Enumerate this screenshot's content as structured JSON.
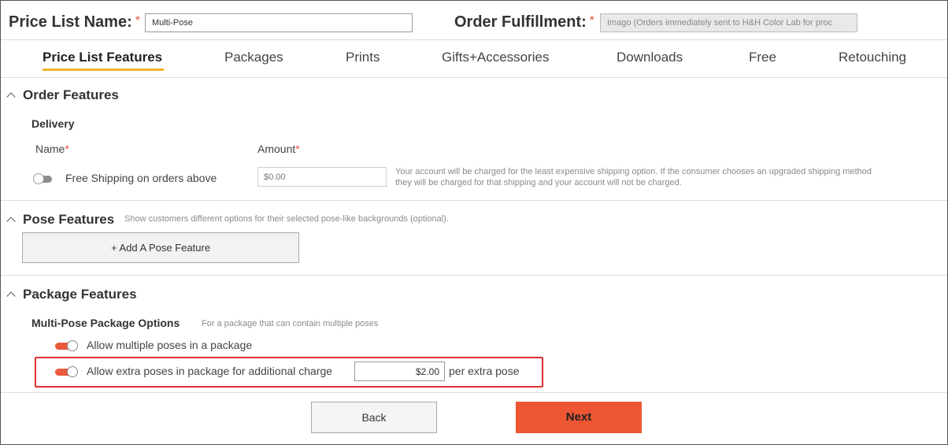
{
  "header": {
    "price_list_label": "Price List Name:",
    "required_mark": "*",
    "price_list_value": "Multi-Pose",
    "order_fulfillment_label": "Order Fulfillment:",
    "order_fulfillment_value": "Imago (Orders immediately sent to H&H Color Lab for proc"
  },
  "tabs": [
    {
      "label": "Price List Features",
      "active": true
    },
    {
      "label": "Packages",
      "active": false
    },
    {
      "label": "Prints",
      "active": false
    },
    {
      "label": "Gifts+Accessories",
      "active": false
    },
    {
      "label": "Downloads",
      "active": false
    },
    {
      "label": "Free",
      "active": false
    },
    {
      "label": "Retouching",
      "active": false
    }
  ],
  "order_features": {
    "title": "Order Features",
    "delivery_title": "Delivery",
    "name_header": "Name",
    "amount_header": "Amount",
    "required_mark": "*",
    "free_shipping_label": "Free Shipping on orders above",
    "free_shipping_enabled": false,
    "amount_placeholder": "$0.00",
    "note_line1": "Your account will be charged for the least expensive shipping option. If the consumer chooses an upgraded shipping method",
    "note_line2": "they will be charged for that shipping and your account will not be charged."
  },
  "pose_features": {
    "title": "Pose Features",
    "description": "Show customers different options for their selected pose-like backgrounds (optional).",
    "add_button_label": "+ Add A Pose Feature"
  },
  "package_features": {
    "title": "Package Features",
    "options_title": "Multi-Pose Package Options",
    "options_description": "For a package that can contain multiple poses",
    "allow_multiple_label": "Allow multiple poses in a package",
    "allow_multiple_enabled": true,
    "allow_extra_label": "Allow extra poses in package for additional charge",
    "allow_extra_enabled": true,
    "extra_price_value": "$2.00",
    "extra_price_suffix": "per extra pose"
  },
  "footer": {
    "back_label": "Back",
    "next_label": "Next"
  },
  "colors": {
    "accent_orange": "#ee5533",
    "tab_underline": "#f0b429",
    "highlight_red": "#e0353b",
    "required_red": "#e5533d"
  }
}
